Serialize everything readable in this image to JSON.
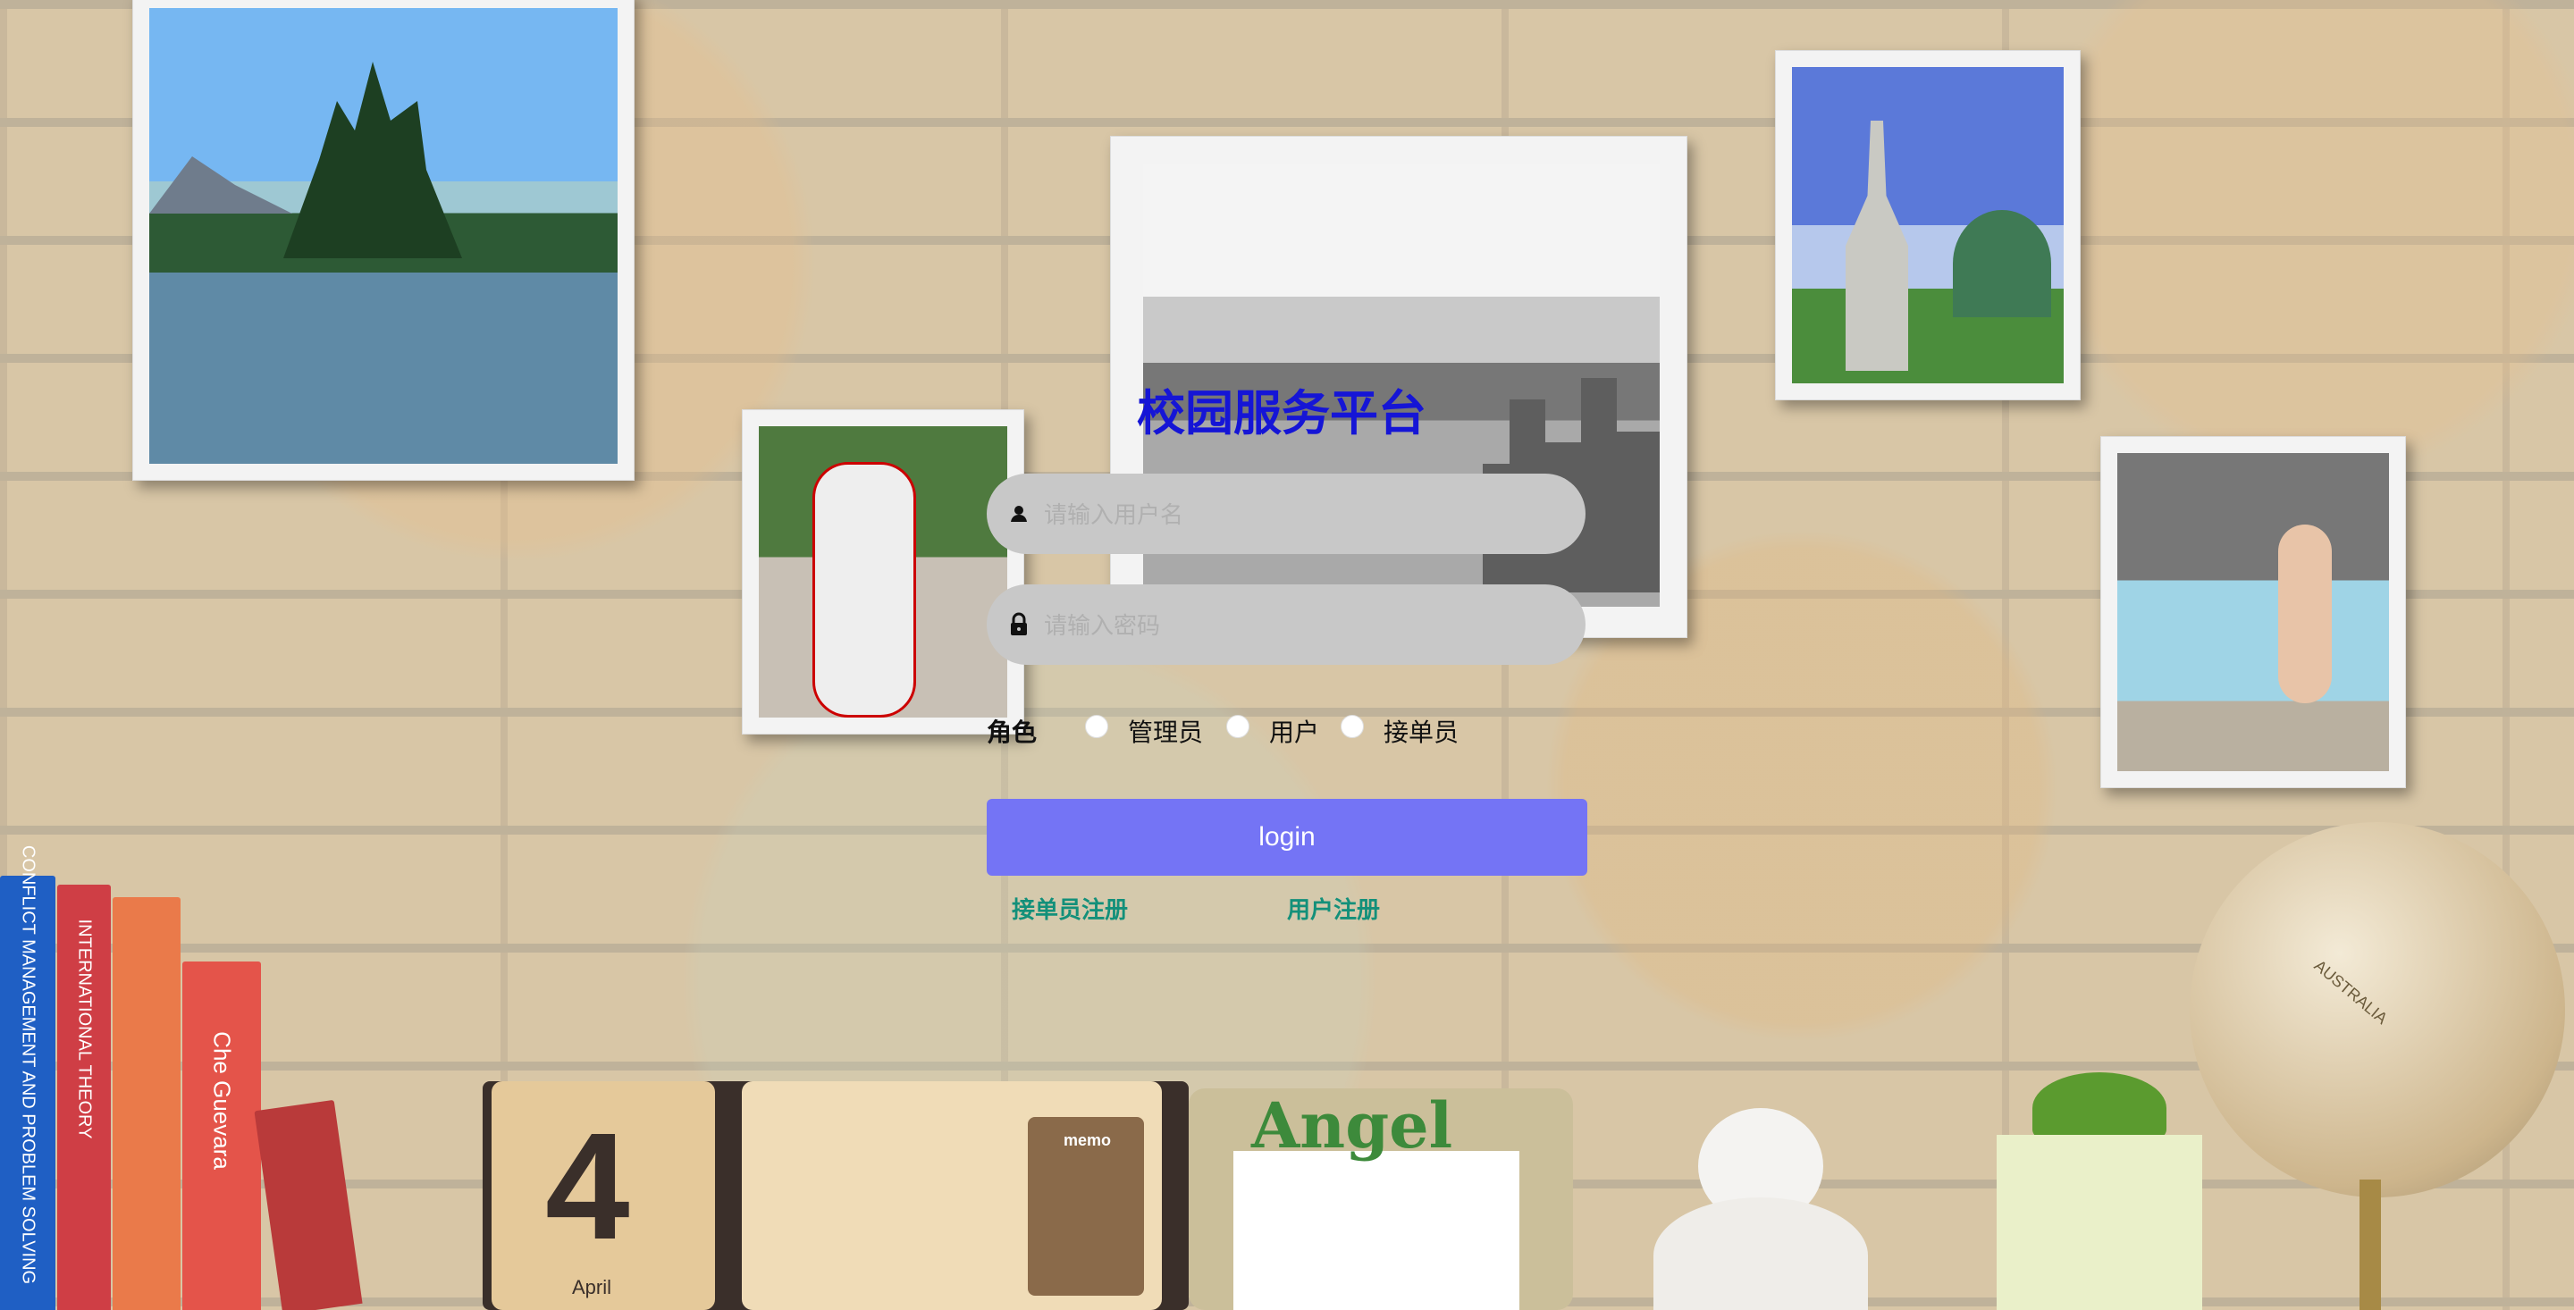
{
  "app": {
    "title": "校园服务平台"
  },
  "login": {
    "username_placeholder": "请输入用户名",
    "password_placeholder": "请输入密码",
    "role_label": "角色",
    "roles": [
      "管理员",
      "用户",
      "接单员"
    ],
    "submit_label": "login",
    "links": [
      "接单员注册",
      "用户注册"
    ]
  },
  "decor": {
    "books": [
      "CONFLICT MANAGEMENT AND PROBLEM SOLVING",
      "INTERNATIONAL THEORY",
      "Che Guevara"
    ],
    "calendar_day": "4",
    "calendar_month": "April",
    "memo_label": "memo",
    "frame_label": "Angel",
    "globe_label": "AUSTRALIA"
  },
  "colors": {
    "title": "#1515d6",
    "button": "#7474f5",
    "link": "#13907a",
    "field": "#c8c8c8"
  }
}
